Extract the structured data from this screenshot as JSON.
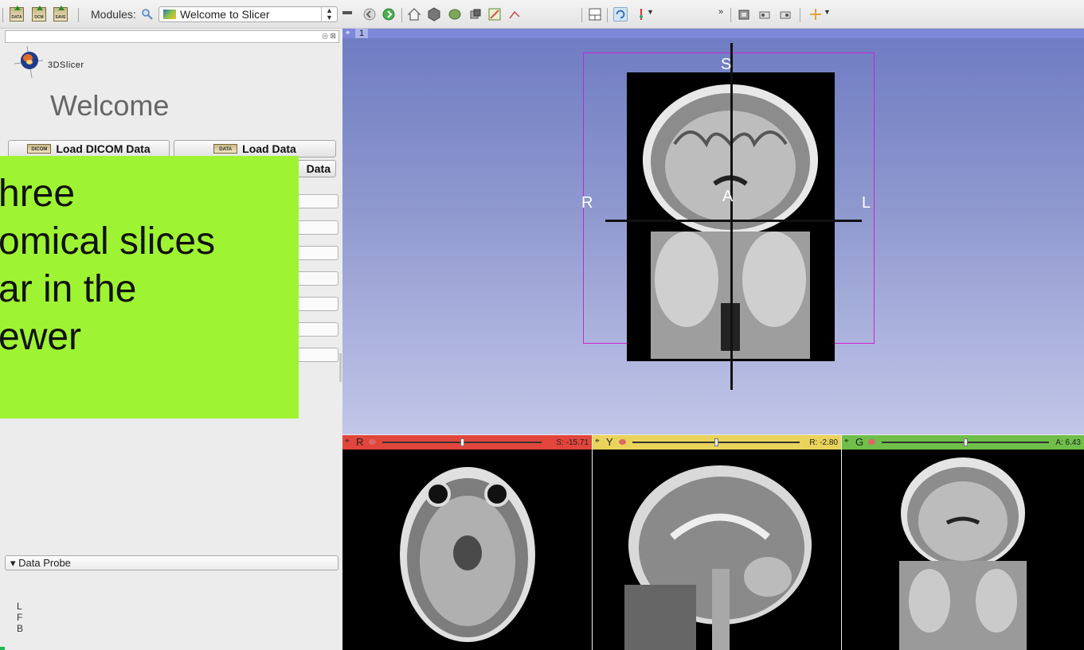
{
  "toolbar": {
    "data_label": "DATA",
    "dcm_label": "DCM",
    "save_label": "SAVE",
    "modules_label": "Modules:",
    "module_selected": "Welcome to Slicer"
  },
  "left_panel": {
    "logo_text": "3DSlicer",
    "title": "Welcome",
    "load_dicom_icon": "DICOM",
    "load_dicom_label": "Load DICOM Data",
    "load_data_icon": "DATA",
    "load_data_label": "Load Data",
    "save_data_label": "Data",
    "overlay_lines": [
      "hree",
      "omical slices",
      "ar in the",
      "ewer"
    ],
    "data_probe_label": "Data Probe",
    "probe_lines": [
      "L",
      "F",
      "B"
    ]
  },
  "view3d": {
    "view_number": "1",
    "orient_top": "S",
    "orient_left": "R",
    "orient_right": "L",
    "orient_center": "A"
  },
  "slices": [
    {
      "letter": "R",
      "value": "S: -15.71",
      "color": "#e2453b",
      "thumb": 0.49
    },
    {
      "letter": "Y",
      "value": "R: -2.80",
      "color": "#ead35a",
      "thumb": 0.49
    },
    {
      "letter": "G",
      "value": "A: 6.43",
      "color": "#6fbf4a",
      "thumb": 0.49
    }
  ],
  "colors": {
    "overlay": "#9ef433",
    "view_top": "#6d7bc2",
    "bbox": "#d020d0"
  }
}
